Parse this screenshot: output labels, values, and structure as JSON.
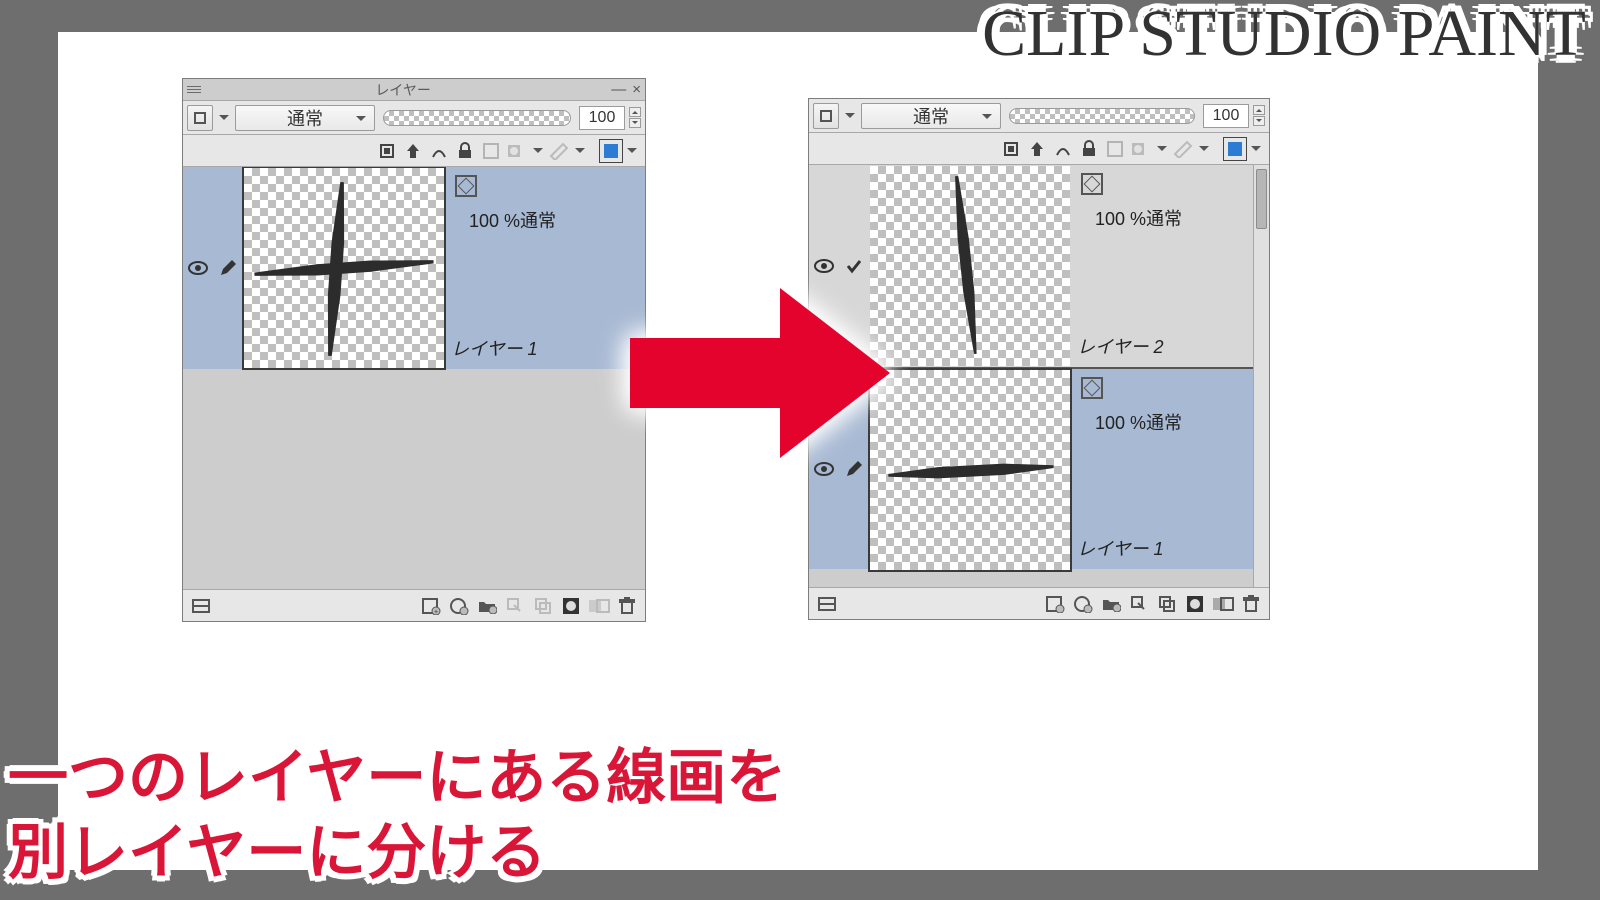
{
  "title": "CLIP STUDIO PAINT",
  "caption_line1": "一つのレイヤーにある線画を",
  "caption_line2": "別レイヤーに分ける",
  "panel_left": {
    "window_title": "レイヤー",
    "blend_mode": "通常",
    "opacity_value": "100",
    "layers": [
      {
        "opacity_label": "100 %通常",
        "name": "レイヤー 1",
        "selected": true,
        "thumb": "cross"
      }
    ]
  },
  "panel_right": {
    "blend_mode": "通常",
    "opacity_value": "100",
    "layers": [
      {
        "opacity_label": "100 %通常",
        "name": "レイヤー 2",
        "selected": false,
        "thumb": "vertical",
        "checked": true
      },
      {
        "opacity_label": "100 %通常",
        "name": "レイヤー 1",
        "selected": true,
        "thumb": "horizontal"
      }
    ]
  },
  "icons": {
    "hamburger": "menu-icon",
    "minimize": "—",
    "close": "×"
  }
}
